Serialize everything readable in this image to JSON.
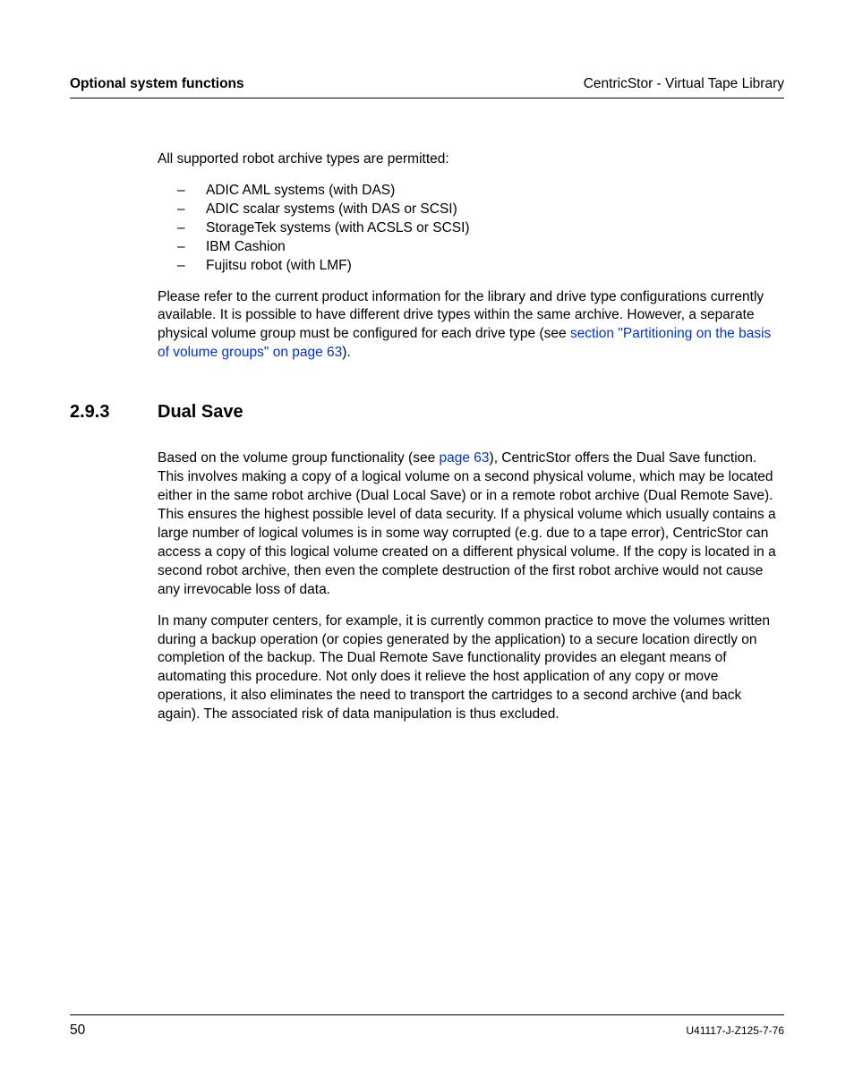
{
  "header": {
    "left": "Optional system functions",
    "right": "CentricStor - Virtual Tape Library"
  },
  "body": {
    "para1": "All supported robot archive types are permitted:",
    "bullets": [
      "ADIC AML systems (with DAS)",
      "ADIC scalar systems (with DAS or SCSI)",
      "StorageTek systems (with ACSLS or SCSI)",
      "IBM Cashion",
      "Fujitsu robot (with LMF)"
    ],
    "para2_a": "Please refer to the current product information for the library and drive type configurations currently available. It is possible to have different drive types within the same archive. However, a separate physical volume group must be configured for each drive type (see ",
    "para2_link": "section \"Partitioning on the basis of volume groups\" on page 63",
    "para2_b": ").",
    "section": {
      "number": "2.9.3",
      "title": "Dual Save"
    },
    "para3_a": "Based on the volume group functionality (see ",
    "para3_link": "page 63",
    "para3_b": "), CentricStor offers the Dual Save function. This involves making a copy of a logical volume on a second physical volume, which may be located either in the same robot archive (Dual Local Save) or in a remote robot archive (Dual Remote Save). This ensures the highest possible level of data security. If a physical volume which usually contains a large number of logical volumes is in some way corrupted (e.g. due to a tape error), CentricStor can access a copy of this logical volume created on a different physical volume. If the copy is located in a second robot archive, then even the complete destruction of the first robot archive would not cause any irrevocable loss of data.",
    "para4": "In many computer centers, for example, it is currently common practice to move the volumes written during a backup operation (or copies generated by the application) to a secure location directly on completion of the backup. The Dual Remote Save functionality provides an elegant means of automating this procedure. Not only does it relieve the host application of any copy or move operations, it also eliminates the need to transport the cartridges to a second archive (and back again). The associated risk of data manipulation is thus excluded."
  },
  "footer": {
    "left": "50",
    "right": "U41117-J-Z125-7-76"
  }
}
